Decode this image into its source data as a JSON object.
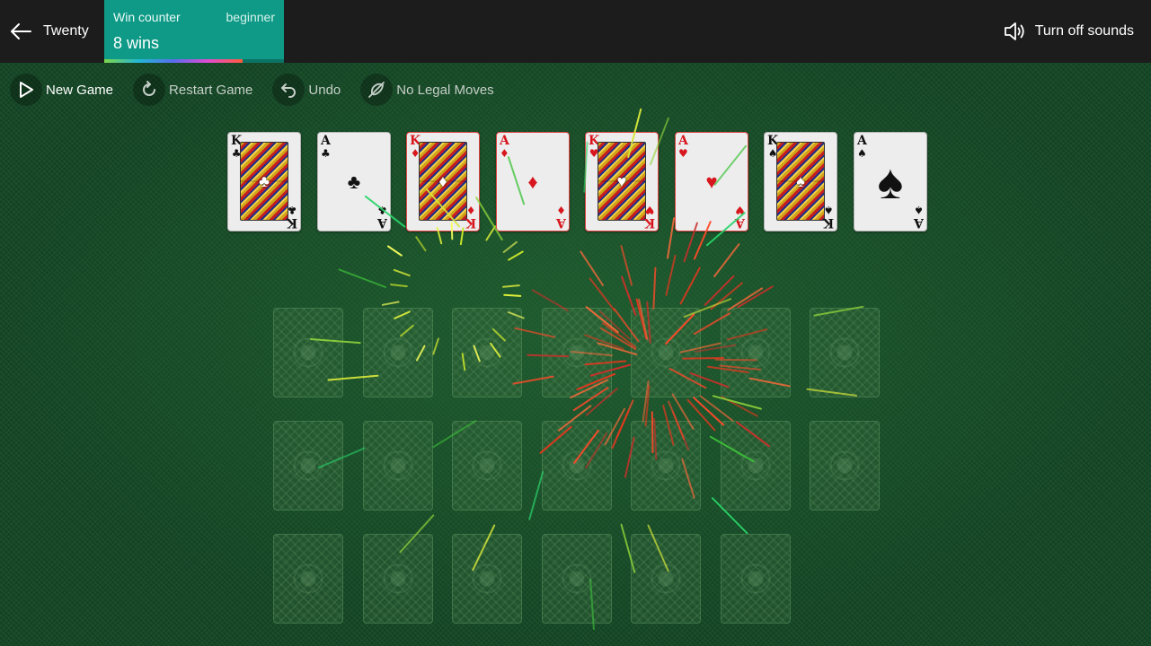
{
  "header": {
    "back_label": "Twenty",
    "win_counter": {
      "title": "Win counter",
      "level": "beginner",
      "count": "8 wins",
      "progress": 0.77
    },
    "sound_label": "Turn off sounds",
    "bar_color": "#1c1c1c",
    "accent_color": "#0f9a87"
  },
  "toolbar": {
    "new_game": "New Game",
    "restart_game": "Restart Game",
    "undo": "Undo",
    "no_legal_moves": "No Legal Moves"
  },
  "foundation": [
    {
      "rank": "K",
      "suit": "♣",
      "color": "black",
      "face": true
    },
    {
      "rank": "A",
      "suit": "♣",
      "color": "black",
      "face": false
    },
    {
      "rank": "K",
      "suit": "♦",
      "color": "red",
      "face": true
    },
    {
      "rank": "A",
      "suit": "♦",
      "color": "red",
      "face": false
    },
    {
      "rank": "K",
      "suit": "♥",
      "color": "red",
      "face": true
    },
    {
      "rank": "A",
      "suit": "♥",
      "color": "red",
      "face": false
    },
    {
      "rank": "K",
      "suit": "♠",
      "color": "black",
      "face": true
    },
    {
      "rank": "A",
      "suit": "♠",
      "color": "black",
      "face": false,
      "big": true
    }
  ],
  "tableau_rows": [
    7,
    7,
    6
  ],
  "felt_color": "#134624"
}
